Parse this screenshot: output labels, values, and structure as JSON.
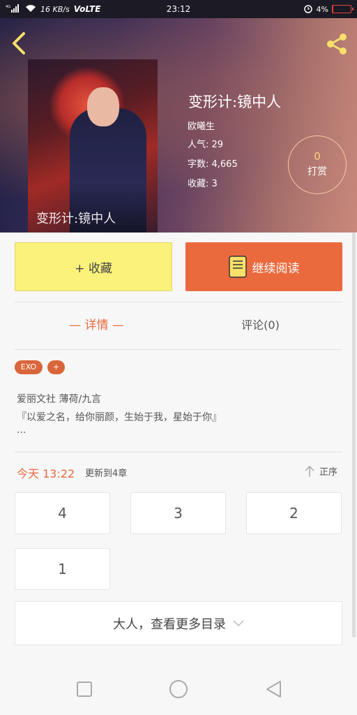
{
  "status_bar": {
    "network": "4G",
    "speed": "16 KB/s",
    "volte": "VoLTE",
    "time": "23:12",
    "battery": "4%",
    "battery_level": 0.04,
    "battery_color": "#e0463c"
  },
  "header": {
    "back_icon": "chevron-left-icon",
    "share_icon": "share-icon",
    "cover_text": "变形计:镜中人"
  },
  "book": {
    "title": "变形计:镜中人",
    "author": "欧曦生",
    "popularity": "人气: 29",
    "word_count": "字数: 4,665",
    "favorites": "收藏: 3"
  },
  "reward": {
    "count": "0",
    "label": "打赏"
  },
  "actions": {
    "favorite_label": "+ 收藏",
    "continue_label": "继续阅读"
  },
  "tabs": {
    "detail": "— 详情 —",
    "comments": "评论(0)"
  },
  "tags": [
    "EXO",
    "+"
  ],
  "description": {
    "line1": "爱丽文社 薄荷/九言",
    "line2": "『以爱之名，给你丽颜，生始于我，星始于你』",
    "line3": "..."
  },
  "update": {
    "time": "今天 13:22",
    "text": "更新到4章",
    "sort_label": "正序"
  },
  "chapters": [
    "4",
    "3",
    "2",
    "1"
  ],
  "more_catalog": "大人，查看更多目录",
  "colors": {
    "accent": "#ea6a3e",
    "favorite_bg": "#fbf27b"
  }
}
